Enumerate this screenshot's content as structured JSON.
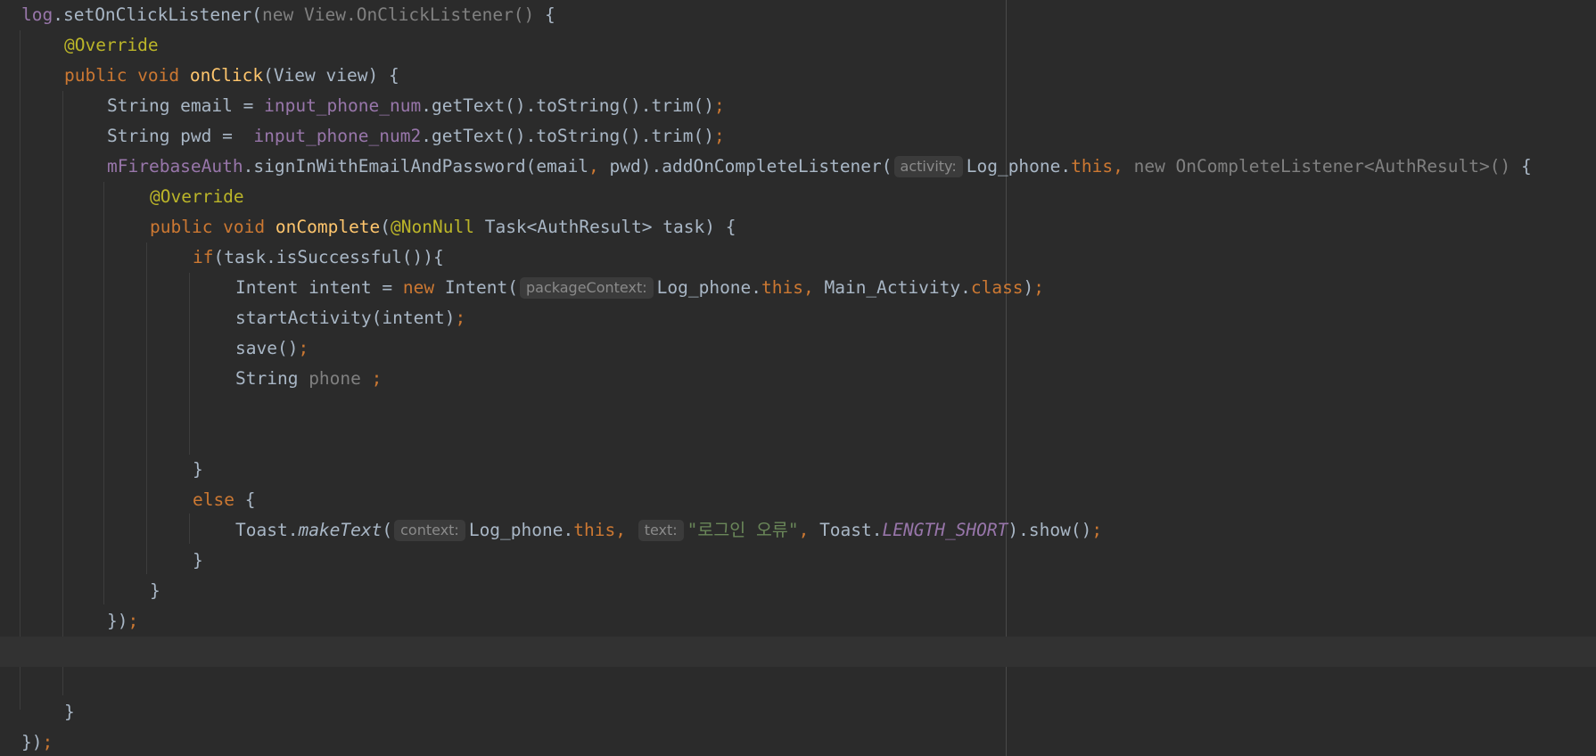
{
  "editor": {
    "lines": [
      {
        "tokens": [
          {
            "t": "log",
            "c": "field"
          },
          {
            "t": ".setOnClickListener("
          },
          {
            "t": "new View.OnClickListener()",
            "c": "grey"
          },
          {
            "t": " {"
          }
        ]
      },
      {
        "tokens": [
          {
            "t": "@Override",
            "c": "ann"
          }
        ]
      },
      {
        "tokens": [
          {
            "t": "public void ",
            "c": "kw"
          },
          {
            "t": "onClick",
            "c": "fn"
          },
          {
            "t": "(View view) {"
          }
        ]
      },
      {
        "tokens": [
          {
            "t": "String email = "
          },
          {
            "t": "input_phone_num",
            "c": "field"
          },
          {
            "t": ".getText().toString().trim()"
          },
          {
            "t": ";",
            "c": "kw"
          }
        ]
      },
      {
        "tokens": [
          {
            "t": "String pwd =  "
          },
          {
            "t": "input_phone_num2",
            "c": "field"
          },
          {
            "t": ".getText().toString().trim()"
          },
          {
            "t": ";",
            "c": "kw"
          }
        ]
      },
      {
        "tokens": [
          {
            "t": "mFirebaseAuth",
            "c": "field"
          },
          {
            "t": ".signInWithEmailAndPassword(email"
          },
          {
            "t": ",",
            "c": "kw"
          },
          {
            "t": " pwd).addOnCompleteListener("
          },
          {
            "hint": "activity:"
          },
          {
            "t": "Log_phone."
          },
          {
            "t": "this,",
            "c": "kw"
          },
          {
            "t": " "
          },
          {
            "t": "new OnCompleteListener<AuthResult>()",
            "c": "grey"
          },
          {
            "t": " {"
          }
        ]
      },
      {
        "tokens": [
          {
            "t": "@Override",
            "c": "ann"
          }
        ]
      },
      {
        "tokens": [
          {
            "t": "public void ",
            "c": "kw"
          },
          {
            "t": "onComplete",
            "c": "fn"
          },
          {
            "t": "("
          },
          {
            "t": "@NonNull",
            "c": "ann"
          },
          {
            "t": " Task<AuthResult> task) {"
          }
        ]
      },
      {
        "tokens": [
          {
            "t": "if",
            "c": "kw"
          },
          {
            "t": "(task.isSuccessful()){"
          }
        ]
      },
      {
        "tokens": [
          {
            "t": "Intent intent = "
          },
          {
            "t": "new ",
            "c": "kw"
          },
          {
            "t": "Intent("
          },
          {
            "hint": "packageContext:"
          },
          {
            "t": "Log_phone."
          },
          {
            "t": "this,",
            "c": "kw"
          },
          {
            "t": " Main_Activity."
          },
          {
            "t": "class",
            "c": "kw"
          },
          {
            "t": ")"
          },
          {
            "t": ";",
            "c": "kw"
          }
        ]
      },
      {
        "tokens": [
          {
            "t": "startActivity(intent)"
          },
          {
            "t": ";",
            "c": "kw"
          }
        ]
      },
      {
        "tokens": [
          {
            "t": "save()"
          },
          {
            "t": ";",
            "c": "kw"
          }
        ]
      },
      {
        "tokens": [
          {
            "t": "String "
          },
          {
            "t": "phone ",
            "c": "grey"
          },
          {
            "t": ";",
            "c": "kw"
          }
        ]
      },
      {
        "tokens": []
      },
      {
        "tokens": []
      },
      {
        "tokens": [
          {
            "t": "}"
          }
        ]
      },
      {
        "tokens": [
          {
            "t": "else",
            "c": "kw"
          },
          {
            "t": " {"
          }
        ]
      },
      {
        "tokens": [
          {
            "t": "Toast."
          },
          {
            "t": "makeText",
            "c": "italic"
          },
          {
            "t": "("
          },
          {
            "hint": "context:"
          },
          {
            "t": "Log_phone."
          },
          {
            "t": "this,",
            "c": "kw"
          },
          {
            "t": " "
          },
          {
            "hint": "text:"
          },
          {
            "t": "\"로그인 오류\"",
            "c": "str"
          },
          {
            "t": ",",
            "c": "kw"
          },
          {
            "t": " Toast."
          },
          {
            "t": "LENGTH_SHORT",
            "c": "static"
          },
          {
            "t": ").show()"
          },
          {
            "t": ";",
            "c": "kw"
          }
        ]
      },
      {
        "tokens": [
          {
            "t": "}"
          }
        ]
      },
      {
        "tokens": [
          {
            "t": "}"
          }
        ]
      },
      {
        "tokens": [
          {
            "t": "})"
          },
          {
            "t": ";",
            "c": "kw"
          }
        ]
      },
      {
        "tokens": []
      },
      {
        "tokens": []
      },
      {
        "tokens": [
          {
            "t": "}"
          }
        ]
      },
      {
        "tokens": [
          {
            "t": "})"
          },
          {
            "t": ";",
            "c": "kw"
          }
        ]
      }
    ]
  }
}
